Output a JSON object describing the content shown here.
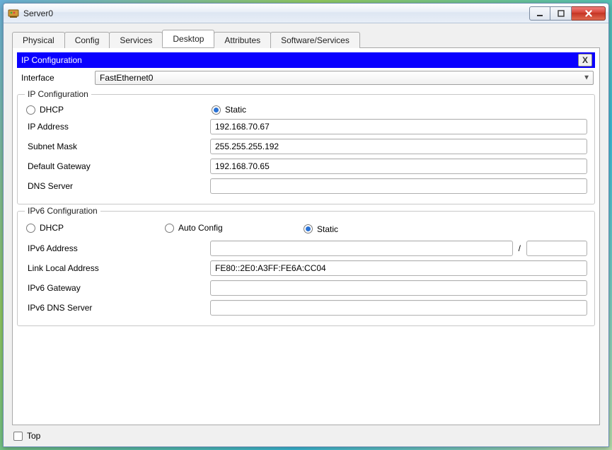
{
  "window": {
    "title": "Server0"
  },
  "win_buttons": {
    "min_tip": "Minimize",
    "max_tip": "Maximize",
    "close_tip": "Close"
  },
  "tabs": [
    {
      "label": "Physical"
    },
    {
      "label": "Config"
    },
    {
      "label": "Services"
    },
    {
      "label": "Desktop"
    },
    {
      "label": "Attributes"
    },
    {
      "label": "Software/Services"
    }
  ],
  "active_tab_index": 3,
  "panel": {
    "title": "IP Configuration",
    "close_label": "X",
    "interface_label": "Interface",
    "interface_value": "FastEthernet0"
  },
  "ipv4": {
    "legend": "IP Configuration",
    "dhcp_label": "DHCP",
    "static_label": "Static",
    "mode": "static",
    "ip_label": "IP Address",
    "ip_value": "192.168.70.67",
    "mask_label": "Subnet Mask",
    "mask_value": "255.255.255.192",
    "gw_label": "Default Gateway",
    "gw_value": "192.168.70.65",
    "dns_label": "DNS Server",
    "dns_value": ""
  },
  "ipv6": {
    "legend": "IPv6 Configuration",
    "dhcp_label": "DHCP",
    "auto_label": "Auto Config",
    "static_label": "Static",
    "mode": "static",
    "addr_label": "IPv6 Address",
    "addr_value": "",
    "prefix_sep": "/",
    "prefix_value": "",
    "linklocal_label": "Link Local Address",
    "linklocal_value": "FE80::2E0:A3FF:FE6A:CC04",
    "gw_label": "IPv6 Gateway",
    "gw_value": "",
    "dns_label": "IPv6 DNS Server",
    "dns_value": ""
  },
  "footer": {
    "top_label": "Top",
    "top_checked": false
  }
}
